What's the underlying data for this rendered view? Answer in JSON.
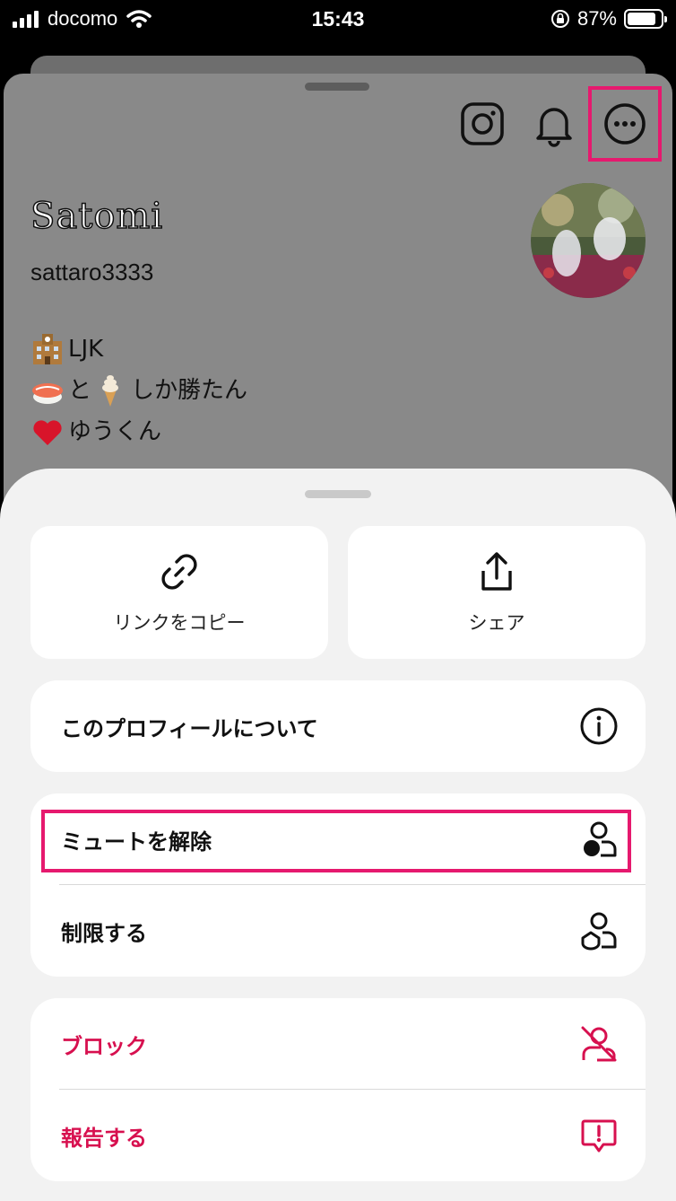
{
  "status_bar": {
    "carrier": "docomo",
    "time": "15:43",
    "battery_percent": "87%",
    "battery_level": 0.87
  },
  "profile": {
    "display_name": "Satomi",
    "username": "sattaro3333",
    "bio": [
      {
        "emoji": "school-building",
        "text": "LJK"
      },
      {
        "emoji": "sushi",
        "text": "と",
        "emoji2": "soft-ice-cream",
        "text2": "しか勝たん"
      },
      {
        "emoji": "red-heart",
        "text": "ゆうくん"
      }
    ],
    "header_icons": [
      "instagram-icon",
      "notification-bell-icon",
      "more-options-icon"
    ]
  },
  "action_sheet": {
    "copy_link_label": "リンクをコピー",
    "share_label": "シェア",
    "about_profile_label": "このプロフィールについて",
    "unmute_label": "ミュートを解除",
    "restrict_label": "制限する",
    "block_label": "ブロック",
    "report_label": "報告する"
  },
  "colors": {
    "accent_red": "#d7104f",
    "highlight": "#e6196e",
    "sheet_background": "#f2f2f2",
    "dimmed_background": "#898989"
  }
}
